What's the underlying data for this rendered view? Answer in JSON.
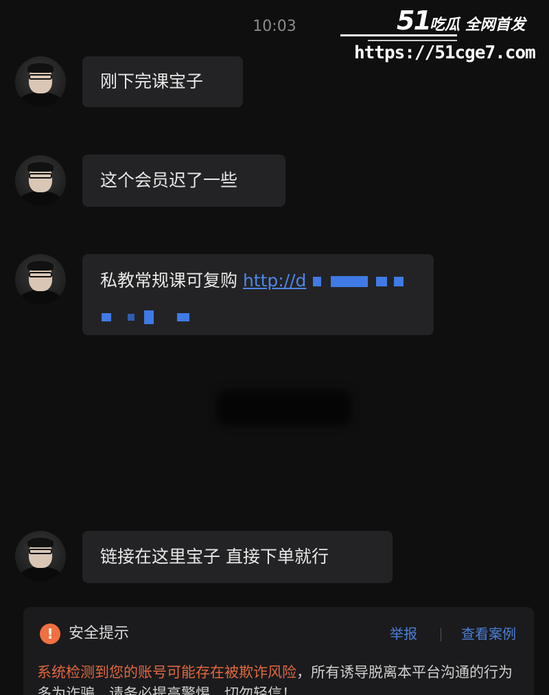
{
  "status_time": "10:03",
  "watermark": {
    "logo_number": "51",
    "title": "吃瓜 全网首发",
    "url": "https://51cge7.com"
  },
  "messages": [
    {
      "text": "刚下完课宝子"
    },
    {
      "text": "这个会员迟了一些"
    },
    {
      "text": "私教常规课可复购 ",
      "link": "http://d"
    },
    {
      "text": "链接在这里宝子 直接下单就行"
    }
  ],
  "safety_notice": {
    "title": "安全提示",
    "report_label": "举报",
    "cases_label": "查看案例",
    "warning_highlight": "系统检测到您的账号可能存在被欺诈风险",
    "warning_rest": "，所有诱导脱离本平台沟通的行为多为诈骗，请务必提高警惕，切勿轻信！"
  },
  "colors": {
    "background": "#0f0f10",
    "bubble": "#232325",
    "link": "#4f86e8",
    "warning": "#e2683e",
    "action": "#4c7fd6"
  }
}
